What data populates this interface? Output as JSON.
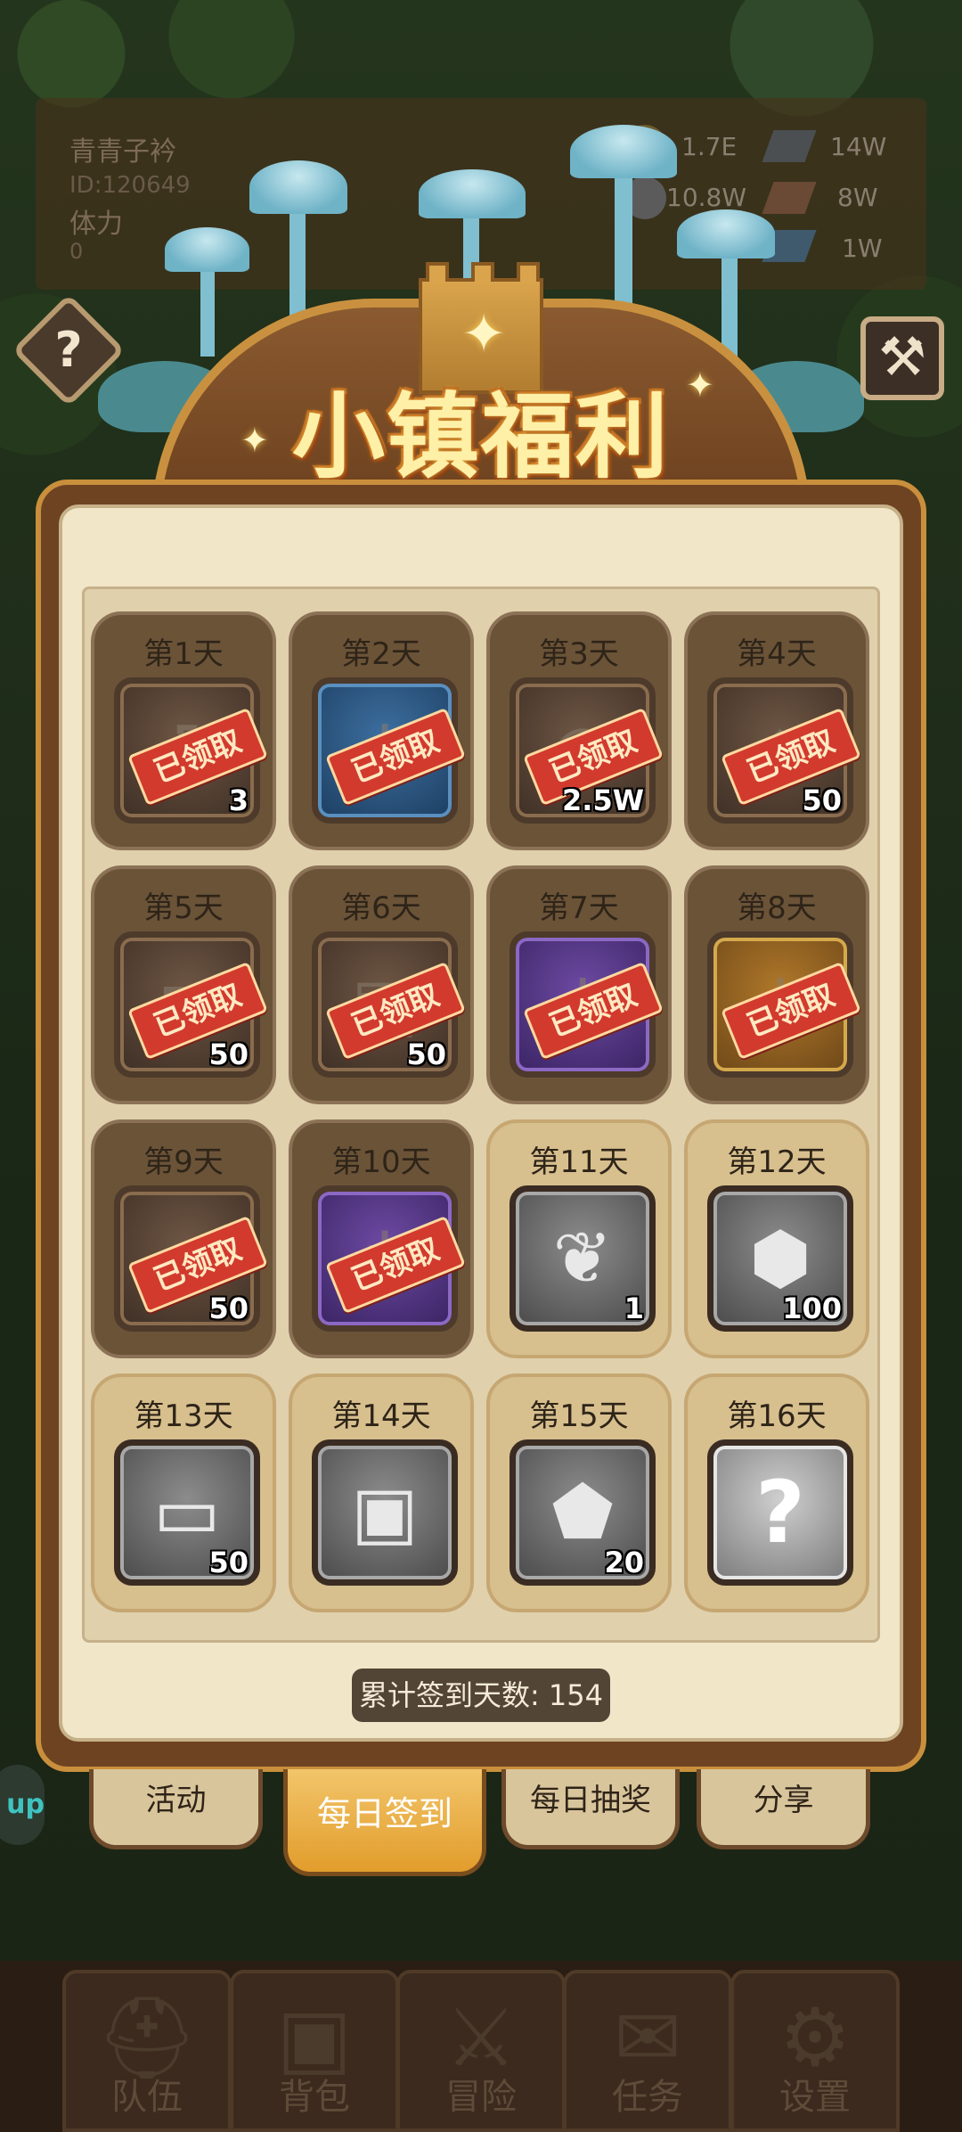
{
  "hud": {
    "player_name": "青青子衿",
    "player_id": "ID:120649",
    "stamina_label": "体力",
    "stamina_value": "0",
    "resources": [
      "1.7E",
      "14W",
      "10.8W",
      "8W",
      "1W"
    ]
  },
  "title": "小镇福利",
  "help_icon": "question-icon",
  "close_icon": "hammer-close-icon",
  "claimed_stamp": "已领取",
  "days": [
    {
      "label": "第1天",
      "qty": "3",
      "claimed": true,
      "icon": "potion-icon",
      "frame": "brown"
    },
    {
      "label": "第2天",
      "qty": "",
      "claimed": true,
      "icon": "key-icon",
      "frame": "blue"
    },
    {
      "label": "第3天",
      "qty": "2.5W",
      "claimed": true,
      "icon": "gold-coin-icon",
      "frame": "brown"
    },
    {
      "label": "第4天",
      "qty": "50",
      "claimed": true,
      "icon": "blue-gem-icon",
      "frame": "brown"
    },
    {
      "label": "第5天",
      "qty": "50",
      "claimed": true,
      "icon": "ore-icon",
      "frame": "brown"
    },
    {
      "label": "第6天",
      "qty": "50",
      "claimed": true,
      "icon": "cloth-icon",
      "frame": "brown"
    },
    {
      "label": "第7天",
      "qty": "",
      "claimed": true,
      "icon": "key-icon",
      "frame": "purple"
    },
    {
      "label": "第8天",
      "qty": "",
      "claimed": true,
      "icon": "key-icon",
      "frame": "gold"
    },
    {
      "label": "第9天",
      "qty": "50",
      "claimed": true,
      "icon": "wood-icon",
      "frame": "brown"
    },
    {
      "label": "第10天",
      "qty": "",
      "claimed": true,
      "icon": "sword-icon",
      "frame": "purple"
    },
    {
      "label": "第11天",
      "qty": "1",
      "claimed": false,
      "icon": "feather-icon",
      "frame": "grey"
    },
    {
      "label": "第12天",
      "qty": "100",
      "claimed": false,
      "icon": "rune-gem-icon",
      "frame": "grey"
    },
    {
      "label": "第13天",
      "qty": "50",
      "claimed": false,
      "icon": "log-icon",
      "frame": "grey"
    },
    {
      "label": "第14天",
      "qty": "",
      "claimed": false,
      "icon": "backpack-icon",
      "frame": "grey"
    },
    {
      "label": "第15天",
      "qty": "20",
      "claimed": false,
      "icon": "emblem-stone-icon",
      "frame": "grey"
    },
    {
      "label": "第16天",
      "qty": "",
      "claimed": false,
      "icon": "mystery-question-icon",
      "frame": "silver"
    }
  ],
  "total_checkin": "累计签到天数: 154",
  "tabs": [
    {
      "label": "活动",
      "active": false
    },
    {
      "label": "每日签到",
      "active": true
    },
    {
      "label": "每日抽奖",
      "active": false
    },
    {
      "label": "分享",
      "active": false
    }
  ],
  "side_tag": "up",
  "nav": [
    {
      "label": "队伍",
      "icon": "helmet-icon"
    },
    {
      "label": "背包",
      "icon": "backpack-icon"
    },
    {
      "label": "冒险",
      "icon": "crossed-swords-icon"
    },
    {
      "label": "任务",
      "icon": "quest-scroll-icon"
    },
    {
      "label": "设置",
      "icon": "gear-icon"
    }
  ]
}
